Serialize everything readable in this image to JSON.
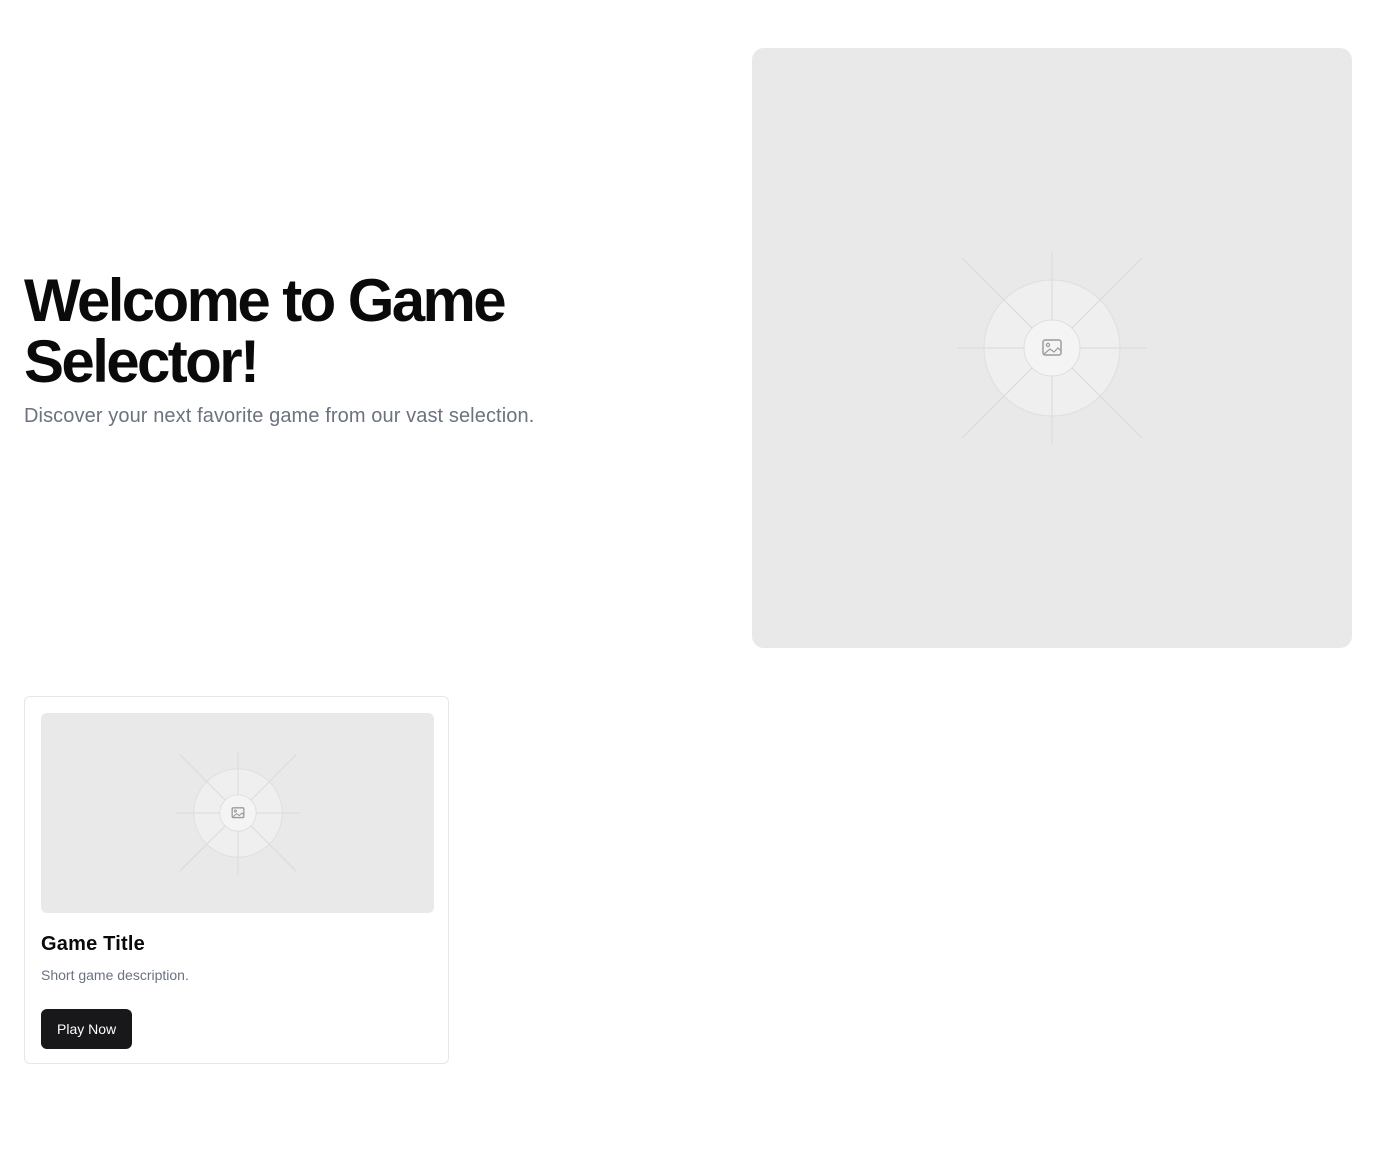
{
  "hero": {
    "title": "Welcome to Game Selector!",
    "subtitle": "Discover your next favorite game from our vast selection.",
    "image_icon": "image-icon"
  },
  "games": [
    {
      "title": "Game Title",
      "description": "Short game description.",
      "button_label": "Play Now",
      "image_icon": "image-icon"
    }
  ],
  "colors": {
    "placeholder_bg": "#e9e9e9",
    "button_bg": "#18181b",
    "muted_text": "#6b7280"
  }
}
